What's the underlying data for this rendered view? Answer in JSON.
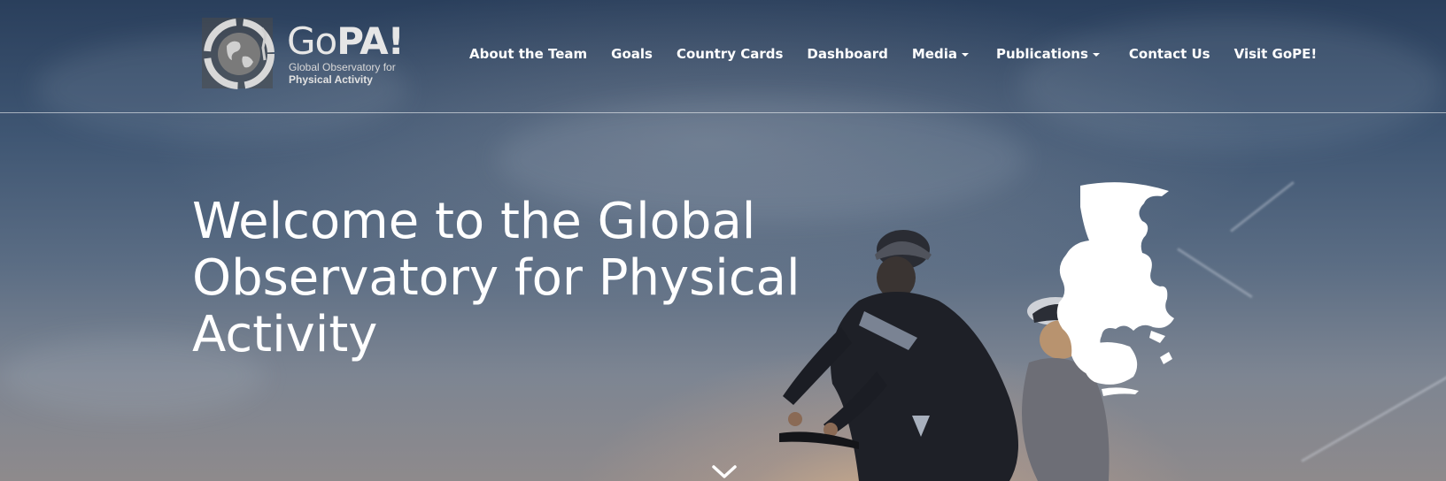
{
  "brand": {
    "logo_word_go": "Go",
    "logo_word_pa": "PA!",
    "logo_subtitle_line1": "Global Observatory for",
    "logo_subtitle_line2": "Physical Activity"
  },
  "nav": {
    "items": [
      {
        "label": "About the Team",
        "dropdown": false
      },
      {
        "label": "Goals",
        "dropdown": false
      },
      {
        "label": "Country Cards",
        "dropdown": false
      },
      {
        "label": "Dashboard",
        "dropdown": false
      },
      {
        "label": "Media",
        "dropdown": true
      },
      {
        "label": "Publications",
        "dropdown": true
      },
      {
        "label": "Contact Us",
        "dropdown": false
      },
      {
        "label": "Visit GoPE!",
        "dropdown": false
      }
    ]
  },
  "hero": {
    "headline_line1": "Welcome to the Global",
    "headline_line2": "Observatory for Physical",
    "headline_line3": "Activity"
  },
  "icons": {
    "scroll": "chevron-down-icon",
    "globe": "globe-icon"
  },
  "colors": {
    "text": "#ffffff",
    "sky_top": "#2a3f5c",
    "sunset_glow": "#e8bc8c"
  }
}
